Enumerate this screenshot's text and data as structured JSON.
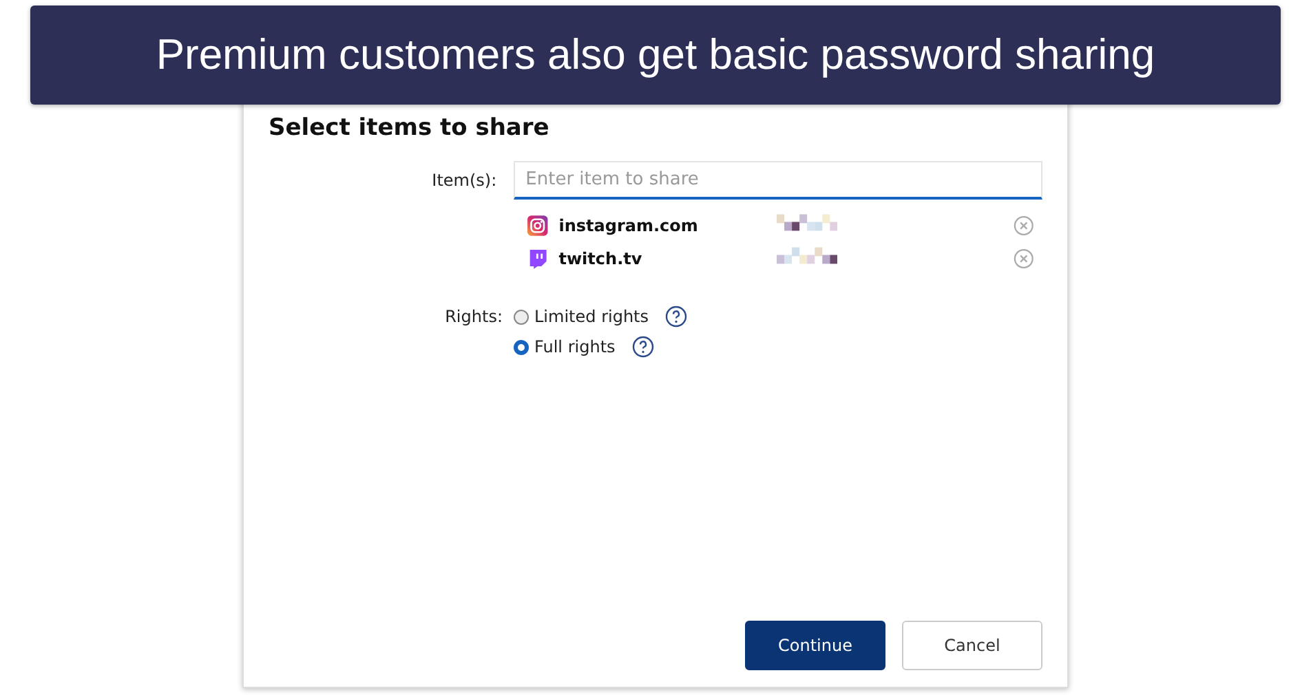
{
  "banner": {
    "text": "Premium customers also get basic password sharing"
  },
  "dialog": {
    "title": "Select items to share",
    "items_field": {
      "label": "Item(s):",
      "placeholder": "Enter item to share"
    },
    "items": [
      {
        "kind": "instagram",
        "name": "instagram.com"
      },
      {
        "kind": "twitch",
        "name": "twitch.tv"
      }
    ],
    "rights": {
      "label": "Rights:",
      "options": [
        {
          "label": "Limited rights",
          "selected": false
        },
        {
          "label": "Full rights",
          "selected": true
        }
      ]
    },
    "buttons": [
      {
        "kind": "primary",
        "label": "Continue"
      },
      {
        "kind": "secondary",
        "label": "Cancel"
      }
    ]
  }
}
